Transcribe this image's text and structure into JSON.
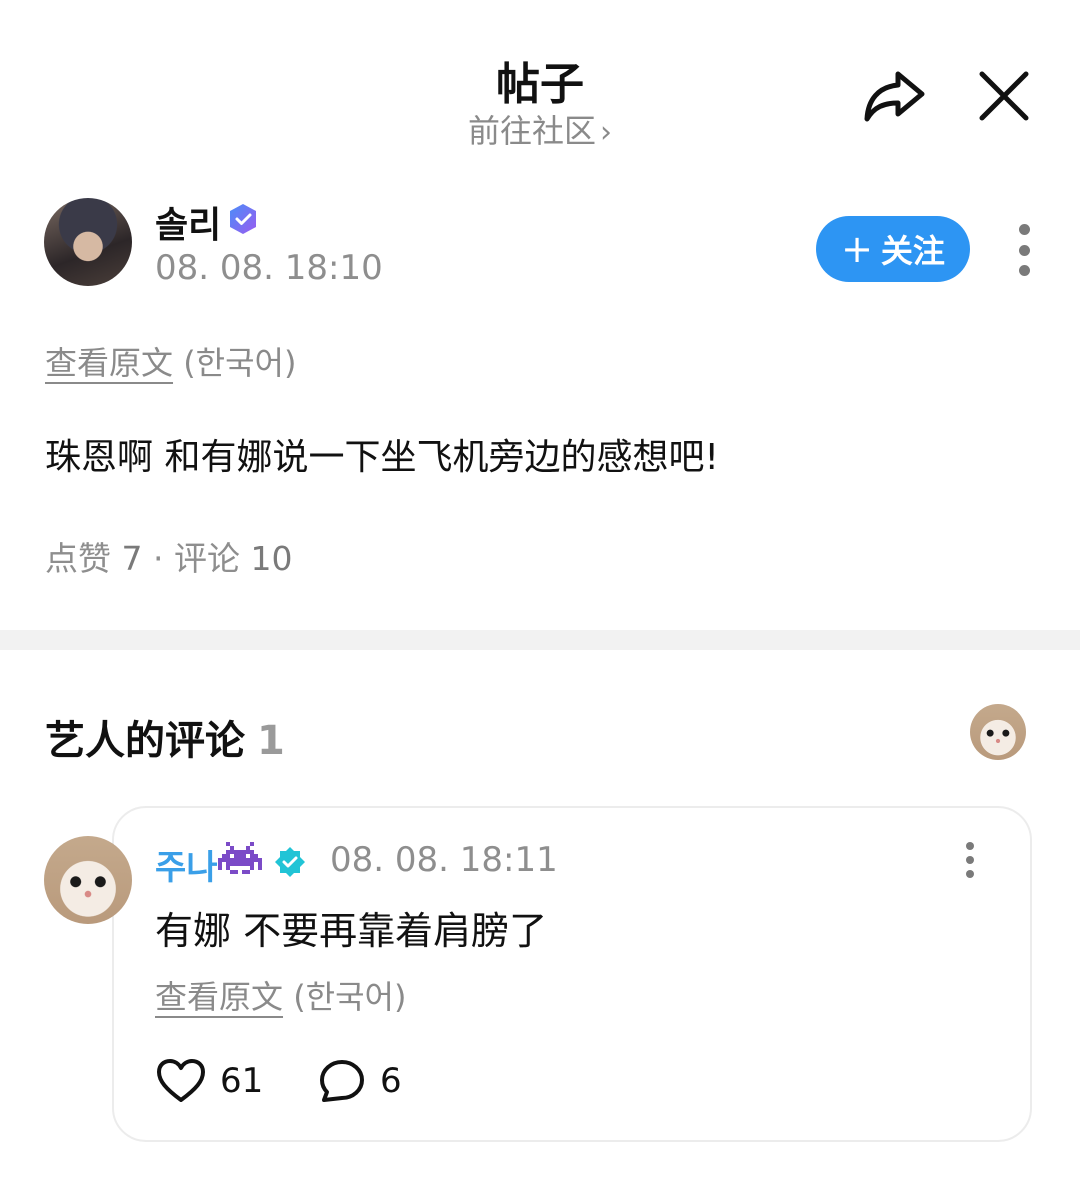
{
  "header": {
    "title": "帖子",
    "subtitle": "前往社区",
    "subtitle_chevron": "›"
  },
  "post": {
    "author": "솔리",
    "time": "08. 08. 18:10",
    "follow_label": "关注",
    "follow_icon": "+",
    "view_original_label": "查看原文",
    "view_original_lang": "(한국어)",
    "text": "珠恩啊 和有娜说一下坐飞机旁边的感想吧!",
    "likes_label": "点赞",
    "likes_count": "7",
    "separator": "·",
    "comments_label": "评论",
    "comments_count": "10"
  },
  "artist_comments": {
    "title": "艺人的评论",
    "count": "1",
    "comment": {
      "author": "주나",
      "time": "08. 08. 18:11",
      "text": "有娜 不要再靠着肩膀了",
      "view_original_label": "查看原文",
      "view_original_lang": "(한국어)",
      "likes": "61",
      "replies": "6"
    }
  },
  "colors": {
    "accent": "#2d95f3",
    "name_blue": "#3a9fe8",
    "verified_purple": "#6f6cf5",
    "verified_teal": "#21c4d6",
    "emoji_purple": "#7b4bc7"
  },
  "icons": [
    "share-icon",
    "close-icon",
    "verified-badge-icon",
    "plus-icon",
    "more-vertical-icon",
    "space-invader-emoji-icon",
    "heart-icon",
    "comment-bubble-icon"
  ]
}
